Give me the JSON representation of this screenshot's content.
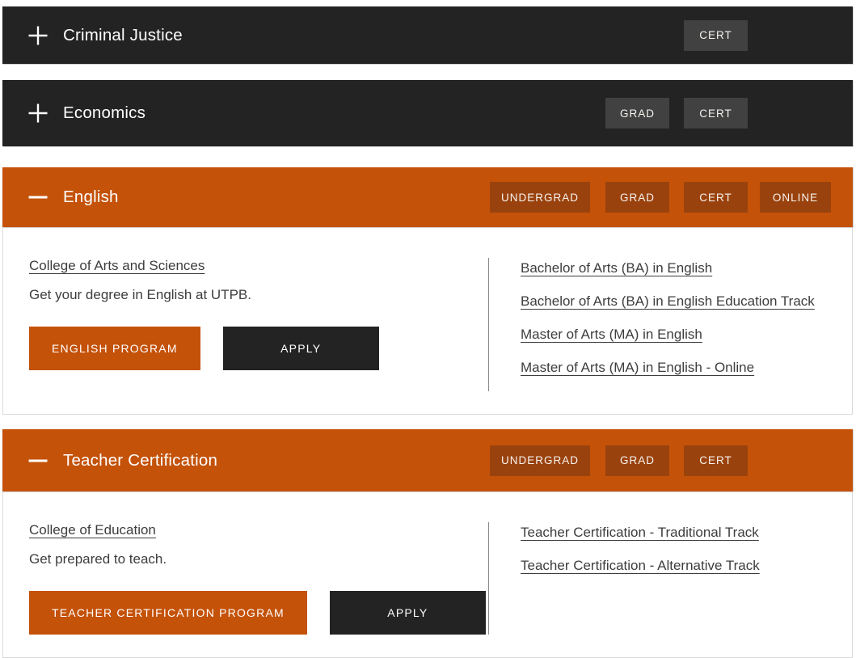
{
  "colors": {
    "accent_orange": "#c45209",
    "badge_orange": "#9a420d",
    "bar_dark": "#232323",
    "badge_dark": "#414141",
    "link_text": "#3d3d3d"
  },
  "sections": [
    {
      "title": "Criminal Justice",
      "state": "collapsed",
      "toggle_icon": "plus",
      "badges": {
        "cert": "CERT"
      }
    },
    {
      "title": "Economics",
      "state": "collapsed",
      "toggle_icon": "plus",
      "badges": {
        "grad": "GRAD",
        "cert": "CERT"
      }
    },
    {
      "title": "English",
      "state": "expanded",
      "toggle_icon": "minus",
      "badges": {
        "undergrad": "UNDERGRAD",
        "grad": "GRAD",
        "cert": "CERT",
        "online": "ONLINE"
      },
      "panel": {
        "college_link": "College of Arts and Sciences",
        "description": "Get your degree in English at UTPB.",
        "program_button": "ENGLISH PROGRAM",
        "apply_button": "APPLY",
        "degree_links": [
          "Bachelor of Arts (BA) in English",
          "Bachelor of Arts (BA) in English Education Track",
          "Master of Arts (MA) in English",
          "Master of Arts (MA) in English - Online"
        ]
      }
    },
    {
      "title": "Teacher Certification",
      "state": "expanded",
      "toggle_icon": "minus",
      "badges": {
        "undergrad": "UNDERGRAD",
        "grad": "GRAD",
        "cert": "CERT"
      },
      "panel": {
        "college_link": "College of Education",
        "description": "Get prepared to teach.",
        "program_button": "TEACHER CERTIFICATION PROGRAM",
        "apply_button": "APPLY",
        "degree_links": [
          "Teacher Certification - Traditional Track",
          "Teacher Certification - Alternative Track"
        ]
      }
    }
  ]
}
